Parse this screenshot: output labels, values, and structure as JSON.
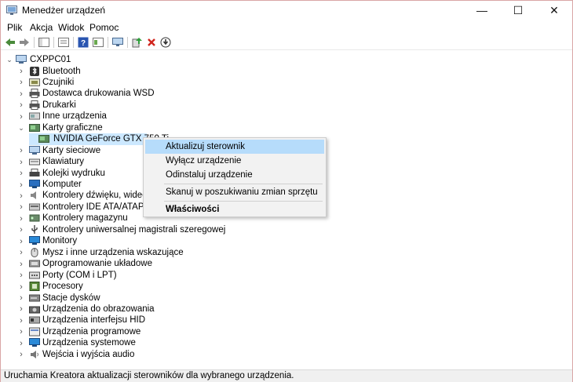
{
  "window": {
    "title": "Menedżer urządzeń",
    "minimize": "—",
    "maximize": "☐",
    "close": "✕"
  },
  "menu": [
    "Plik",
    "Akcja",
    "Widok",
    "Pomoc"
  ],
  "tree": {
    "root": "CXPPC01",
    "items": [
      {
        "label": "Bluetooth",
        "icon": "bluetooth-icon"
      },
      {
        "label": "Czujniki",
        "icon": "sensor-icon"
      },
      {
        "label": "Dostawca drukowania WSD",
        "icon": "printer-icon"
      },
      {
        "label": "Drukarki",
        "icon": "printer-icon"
      },
      {
        "label": "Inne urządzenia",
        "icon": "device-icon"
      },
      {
        "label": "Karty graficzne",
        "icon": "display-adapter-icon"
      },
      {
        "label": "NVIDIA GeForce GTX 750 Ti",
        "icon": "display-adapter-icon"
      },
      {
        "label": "Karty sieciowe",
        "icon": "network-adapter-icon"
      },
      {
        "label": "Klawiatury",
        "icon": "keyboard-icon"
      },
      {
        "label": "Kolejki wydruku",
        "icon": "print-queue-icon"
      },
      {
        "label": "Komputer",
        "icon": "computer-icon"
      },
      {
        "label": "Kontrolery dźwięku, wideo i gier",
        "icon": "speaker-icon"
      },
      {
        "label": "Kontrolery IDE ATA/ATAPI",
        "icon": "ide-icon"
      },
      {
        "label": "Kontrolery magazynu",
        "icon": "storage-icon"
      },
      {
        "label": "Kontrolery uniwersalnej magistrali szeregowej",
        "icon": "usb-icon"
      },
      {
        "label": "Monitory",
        "icon": "monitor-icon"
      },
      {
        "label": "Mysz i inne urządzenia wskazujące",
        "icon": "mouse-icon"
      },
      {
        "label": "Oprogramowanie układowe",
        "icon": "firmware-icon"
      },
      {
        "label": "Porty (COM i LPT)",
        "icon": "port-icon"
      },
      {
        "label": "Procesory",
        "icon": "processor-icon"
      },
      {
        "label": "Stacje dysków",
        "icon": "disk-icon"
      },
      {
        "label": "Urządzenia do obrazowania",
        "icon": "camera-icon"
      },
      {
        "label": "Urządzenia interfejsu HID",
        "icon": "hid-icon"
      },
      {
        "label": "Urządzenia programowe",
        "icon": "software-device-icon"
      },
      {
        "label": "Urządzenia systemowe",
        "icon": "system-device-icon"
      },
      {
        "label": "Wejścia i wyjścia audio",
        "icon": "audio-io-icon"
      }
    ]
  },
  "context_menu": {
    "update": "Aktualizuj sterownik",
    "disable": "Wyłącz urządzenie",
    "uninstall": "Odinstaluj urządzenie",
    "scan": "Skanuj w poszukiwaniu zmian sprzętu",
    "properties": "Właściwości"
  },
  "status": "Uruchamia Kreatora aktualizacji sterowników dla wybranego urządzenia.",
  "colors": {
    "selection": "#cce8ff",
    "highlight": "#b6dcfb",
    "window_border": "#d9a6a6"
  }
}
